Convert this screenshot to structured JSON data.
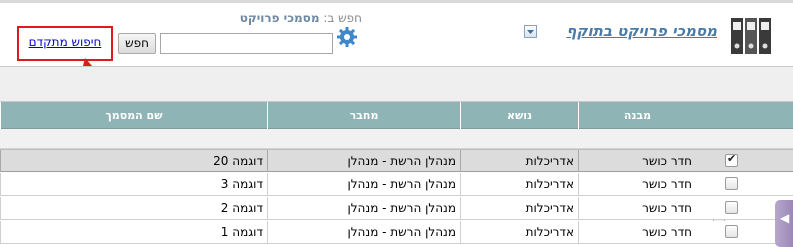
{
  "header": {
    "title": "מסמכי פרויקט בתוקף",
    "title_icon": "binders-icon",
    "dropdown_icon": "chevron-down-icon"
  },
  "search": {
    "search_by_label": "חפש ב:",
    "search_by_value": "מסמכי פרויקט",
    "input_value": "",
    "button_label": "חפש",
    "advanced_label": "חיפוש מתקדם",
    "gear_icon": "gear-icon"
  },
  "table": {
    "columns": [
      "שם המסמך",
      "מחבר",
      "נושא",
      "מבנה"
    ],
    "rows": [
      {
        "name": "דוגמה 20",
        "author": "מנהלן הרשת - מנהלן",
        "subject": "אדריכלות",
        "structure": "חדר כושר",
        "checked": true
      },
      {
        "name": "דוגמה 3",
        "author": "מנהלן הרשת - מנהלן",
        "subject": "אדריכלות",
        "structure": "חדר כושר",
        "checked": false
      },
      {
        "name": "דוגמה 2",
        "author": "מנהלן הרשת - מנהלן",
        "subject": "אדריכלות",
        "structure": "חדר כושר",
        "checked": false
      },
      {
        "name": "דוגמה 1",
        "author": "מנהלן הרשת - מנהלן",
        "subject": "אדריכלות",
        "structure": "חדר כושר",
        "checked": false
      }
    ]
  },
  "colors": {
    "header_bg": "#8fb4b5",
    "title": "#4a7aa8",
    "highlight": "#e0191f",
    "link": "#0000cc"
  }
}
